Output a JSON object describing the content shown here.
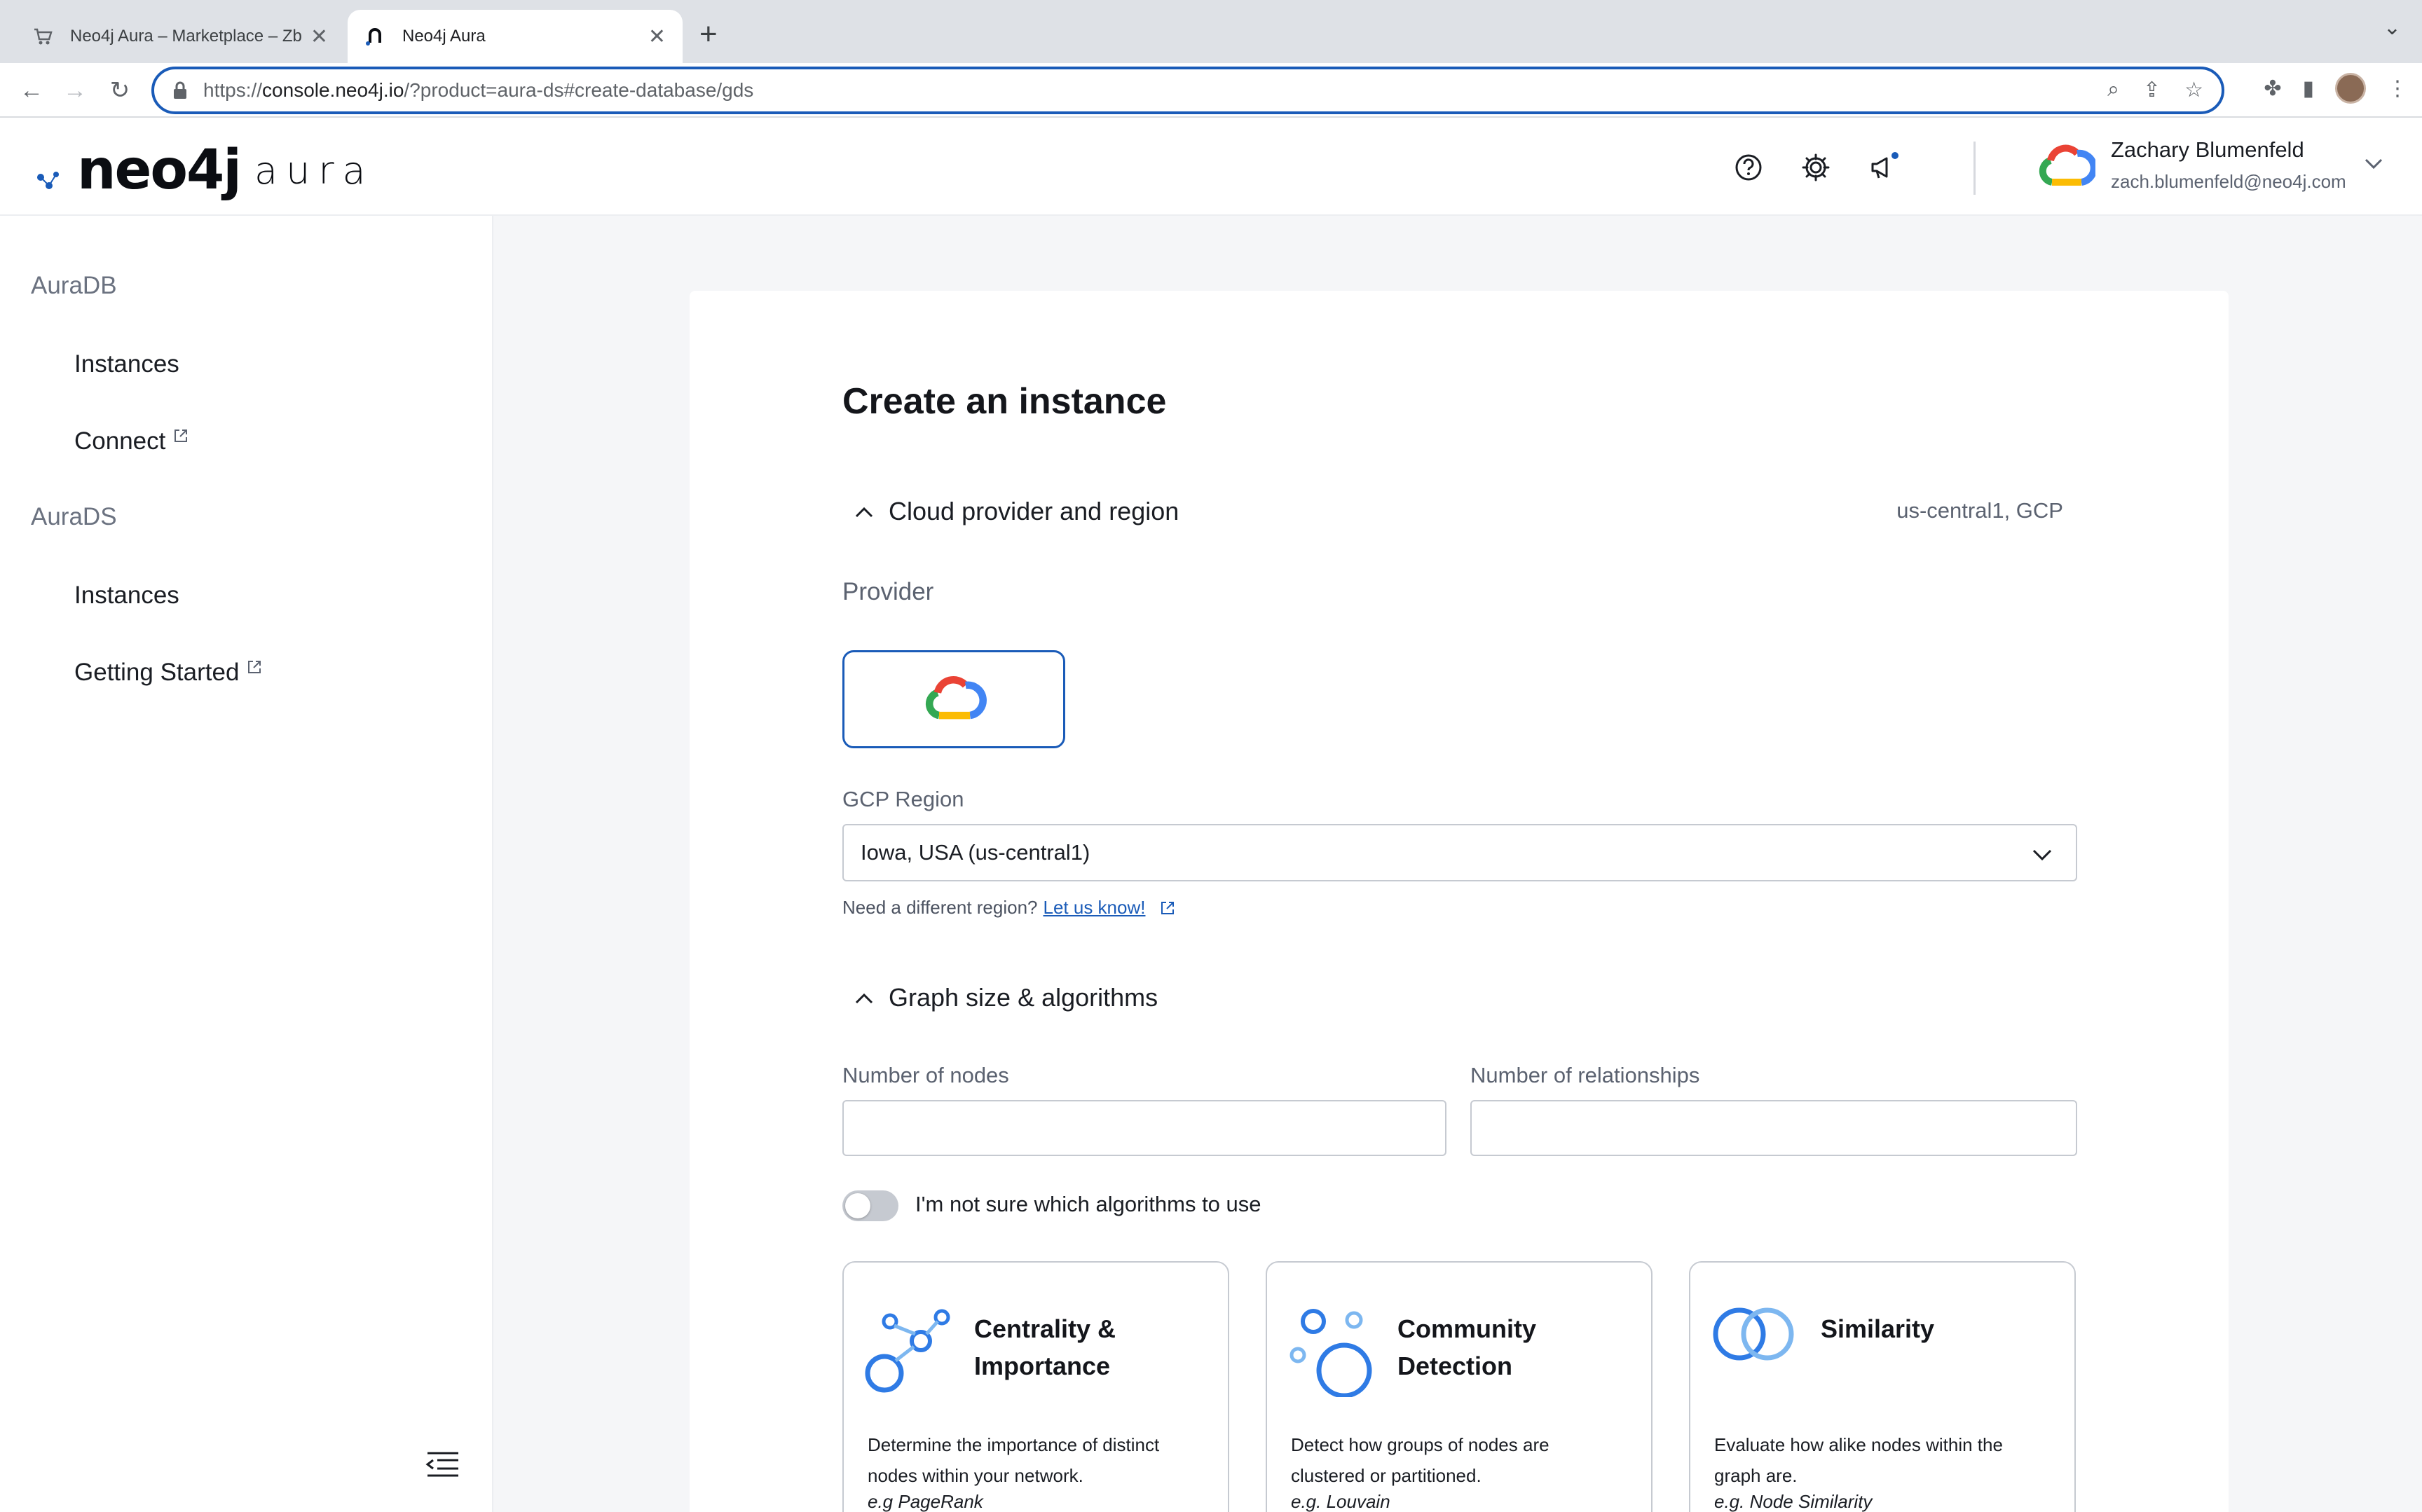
{
  "browser": {
    "tabs": [
      {
        "title": "Neo4j Aura – Marketplace – Zb",
        "active": false
      },
      {
        "title": "Neo4j Aura",
        "active": true
      }
    ],
    "url_prefix": "https://",
    "url_host": "console.neo4j.io",
    "url_rest": "/?product=aura-ds#create-database/gds"
  },
  "header": {
    "logo_text": "neo4j",
    "logo_suffix": "aura",
    "user_name": "Zachary Blumenfeld",
    "user_email": "zach.blumenfeld@neo4j.com",
    "notification_dot_color": "#1a5bb8"
  },
  "sidebar": {
    "sections": [
      {
        "label": "AuraDB",
        "items": [
          {
            "label": "Instances",
            "external": false
          },
          {
            "label": "Connect",
            "external": true
          }
        ]
      },
      {
        "label": "AuraDS",
        "items": [
          {
            "label": "Instances",
            "external": false
          },
          {
            "label": "Getting Started",
            "external": true
          }
        ]
      }
    ]
  },
  "main": {
    "title": "Create an instance",
    "cloud_section": {
      "label": "Cloud provider and region",
      "summary": "us-central1, GCP",
      "provider_label": "Provider",
      "provider_icon": "google-cloud-icon",
      "region_label": "GCP Region",
      "region_value": "Iowa, USA (us-central1)",
      "hint_text": "Need a different region?",
      "hint_link": "Let us know!"
    },
    "graph_section": {
      "label": "Graph size & algorithms",
      "nodes_label": "Number of nodes",
      "nodes_value": "",
      "relationships_label": "Number of relationships",
      "relationships_value": "",
      "toggle_label": "I'm not sure which algorithms to use",
      "toggle_on": false
    },
    "algorithms": [
      {
        "title": "Centrality & Importance",
        "description": "Determine the importance of distinct nodes within your network.",
        "example": "e.g PageRank",
        "icon": "centrality-icon"
      },
      {
        "title": "Community Detection",
        "description": "Detect how groups of nodes are clustered or partitioned.",
        "example": "e.g. Louvain",
        "icon": "community-icon"
      },
      {
        "title": "Similarity",
        "description": "Evaluate how alike nodes within the graph are.",
        "example": "e.g. Node Similarity",
        "icon": "similarity-icon"
      }
    ]
  },
  "colors": {
    "accent": "#1a5bb8",
    "icon_blue": "#2f7be5",
    "icon_light_blue": "#7db7f0"
  }
}
